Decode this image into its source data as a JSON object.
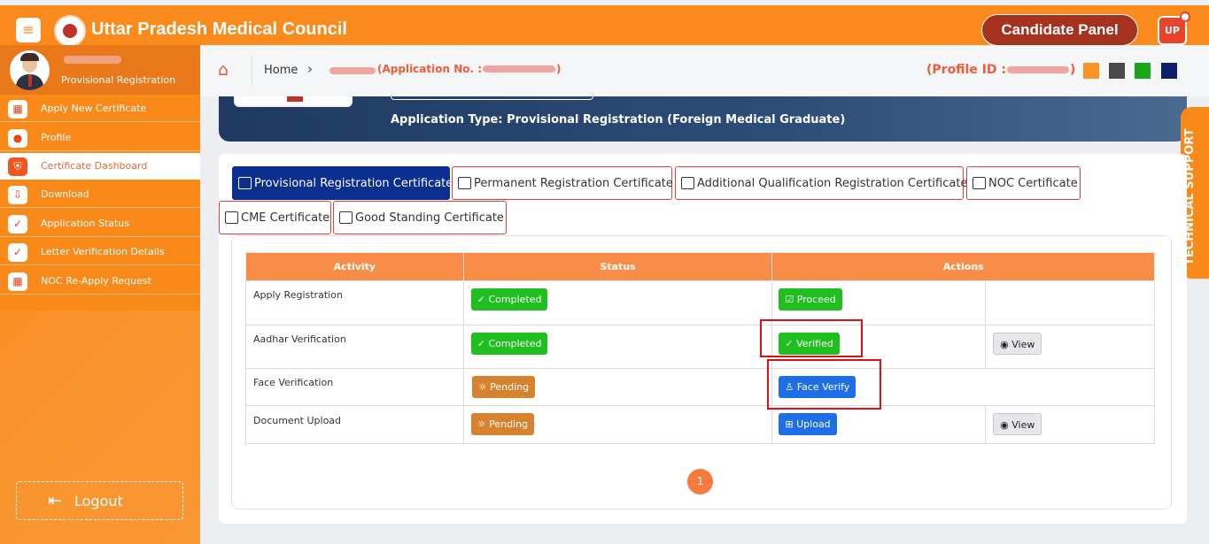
{
  "header": {
    "title": "Uttar Pradesh Medical Council",
    "candidate_panel": "Candidate Panel",
    "avatar_initials": "UP"
  },
  "sidebar": {
    "role": "Provisional Registration",
    "items": [
      {
        "label": "Apply New Certificate",
        "icon": "grid-icon",
        "active": false
      },
      {
        "label": "Profile",
        "icon": "user-icon",
        "active": false
      },
      {
        "label": "Certificate Dashboard",
        "icon": "shield-icon",
        "active": true
      },
      {
        "label": "Download",
        "icon": "download-icon",
        "active": false
      },
      {
        "label": "Application Status",
        "icon": "check-circle-icon",
        "active": false
      },
      {
        "label": "Letter Verification Details",
        "icon": "check-circle-icon",
        "active": false
      },
      {
        "label": "NOC Re-Apply Request",
        "icon": "grid-icon",
        "active": false
      }
    ],
    "logout": "Logout"
  },
  "breadcrumb": {
    "home": "Home",
    "application_no": "(Application No. :",
    "application_no_close": ")",
    "profile_id": "(Profile ID :",
    "profile_id_close": ")",
    "swatches": [
      "#f7941d",
      "#4a4a4a",
      "#1aa51a",
      "#0b1f6b"
    ]
  },
  "banner": {
    "application_type": "Application Type: Provisional Registration (Foreign Medical Graduate)"
  },
  "tech_support": "TECHNICAL SUPPORT",
  "tabs": [
    {
      "label": "Provisional Registration Certificate",
      "active": true
    },
    {
      "label": "Permanent Registration Certificate",
      "active": false
    },
    {
      "label": "Additional Qualification Registration Certificate",
      "active": false
    },
    {
      "label": "NOC Certificate",
      "active": false
    },
    {
      "label": "CME Certificate",
      "active": false
    },
    {
      "label": "Good Standing Certificate",
      "active": false
    }
  ],
  "table": {
    "headers": [
      "Activity",
      "Status",
      "Actions"
    ],
    "rows": [
      {
        "activity": "Apply Registration",
        "status": "✓ Completed",
        "action": "☑ Proceed",
        "extra": ""
      },
      {
        "activity": "Aadhar Verification",
        "status": "✓ Completed",
        "action": "✓ Verified",
        "extra": "◉ View"
      },
      {
        "activity": "Face Verification",
        "status": "☼ Pending",
        "action": "♙ Face Verify",
        "extra": ""
      },
      {
        "activity": "Document Upload",
        "status": "☼ Pending",
        "action": "⊞ Upload",
        "extra": "◉ View"
      }
    ]
  },
  "pagination": {
    "current": "1"
  }
}
